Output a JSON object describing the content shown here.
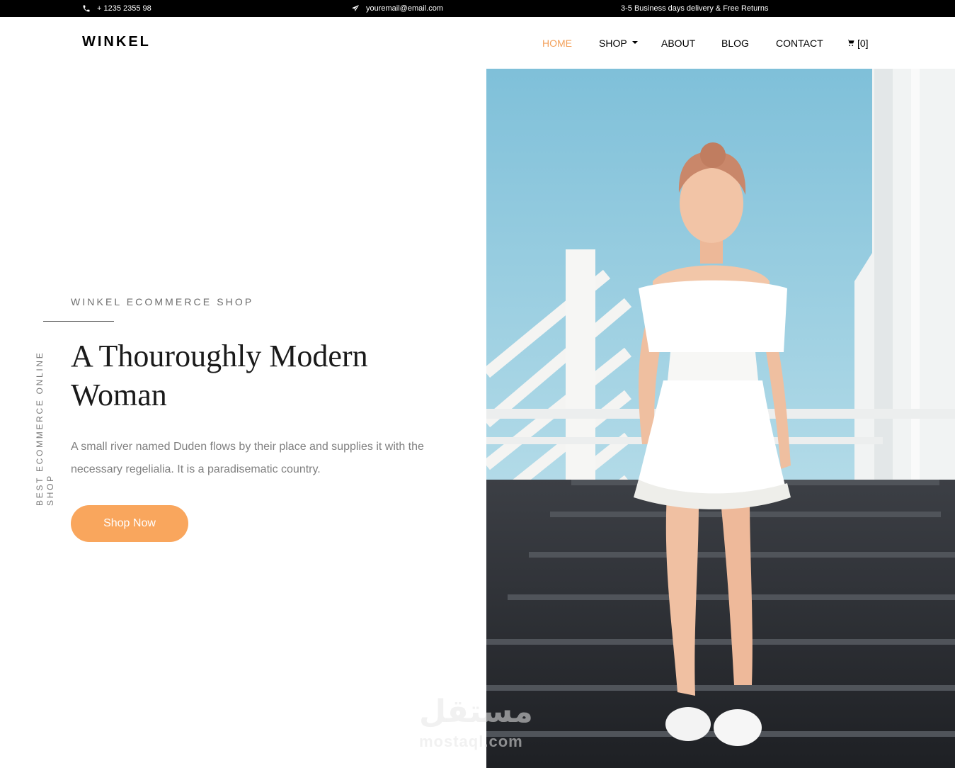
{
  "topbar": {
    "phone": "+ 1235 2355 98",
    "email": "youremail@email.com",
    "delivery": "3-5 Business days delivery & Free Returns"
  },
  "header": {
    "logo": "WINKEL",
    "nav": {
      "home": "HOME",
      "shop": "SHOP",
      "about": "ABOUT",
      "blog": "BLOG",
      "contact": "CONTACT",
      "cart": "[0]"
    }
  },
  "hero": {
    "kicker": "WINKEL ECOMMERCE SHOP",
    "vertical_text": "BEST ECOMMERCE ONLINE SHOP",
    "headline": "A Thouroughly Modern Woman",
    "description": "A small river named Duden flows by their place and supplies it with the necessary regelialia. It is a paradisematic country.",
    "button": "Shop Now"
  },
  "watermark": {
    "arabic": "مستقل",
    "latin": "mostaql.com"
  },
  "colors": {
    "accent": "#f9a65d",
    "active_nav": "#f3a05a",
    "topbar_bg": "#000000"
  },
  "icons": {
    "phone": "phone-icon",
    "email": "paper-plane-icon",
    "cart": "cart-icon",
    "caret": "caret-down-icon"
  }
}
